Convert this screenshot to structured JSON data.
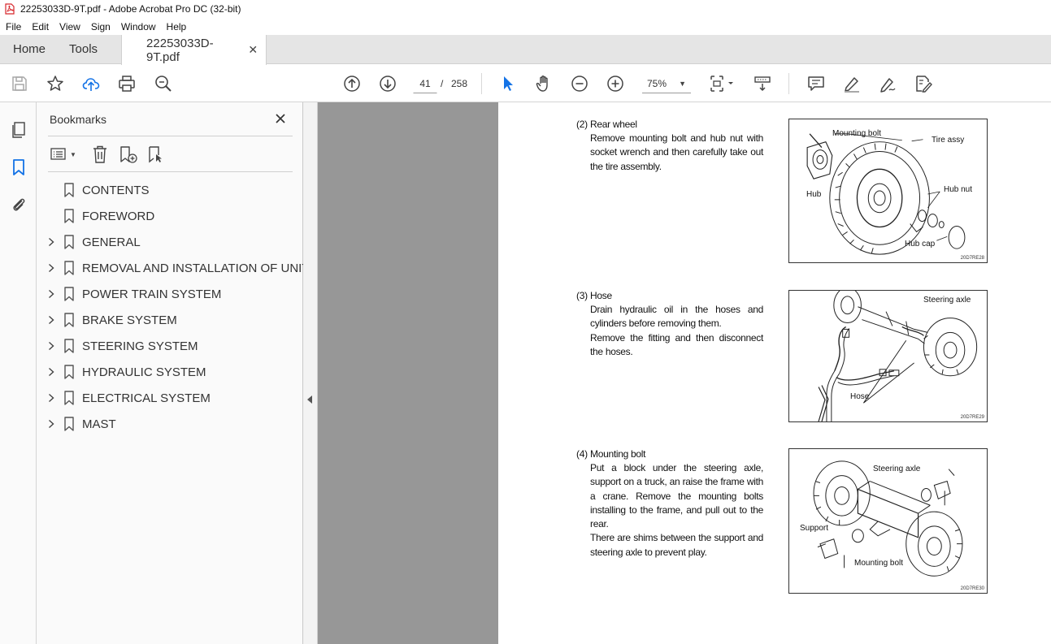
{
  "window": {
    "title": "22253033D-9T.pdf - Adobe Acrobat Pro DC (32-bit)"
  },
  "menu": [
    "File",
    "Edit",
    "View",
    "Sign",
    "Window",
    "Help"
  ],
  "tabs": {
    "home": "Home",
    "tools": "Tools",
    "document": "22253033D-9T.pdf"
  },
  "toolbar": {
    "current_page": "41",
    "page_separator": "/",
    "total_pages": "258",
    "zoom": "75%"
  },
  "bookmarks": {
    "title": "Bookmarks",
    "items": [
      {
        "label": "CONTENTS",
        "expandable": false
      },
      {
        "label": "FOREWORD",
        "expandable": false
      },
      {
        "label": "GENERAL",
        "expandable": true
      },
      {
        "label": "REMOVAL AND INSTALLATION OF UNIT",
        "expandable": true
      },
      {
        "label": "POWER TRAIN SYSTEM",
        "expandable": true
      },
      {
        "label": "BRAKE SYSTEM",
        "expandable": true
      },
      {
        "label": "STEERING SYSTEM",
        "expandable": true
      },
      {
        "label": "HYDRAULIC SYSTEM",
        "expandable": true
      },
      {
        "label": "ELECTRICAL SYSTEM",
        "expandable": true
      },
      {
        "label": "MAST",
        "expandable": true
      }
    ]
  },
  "document": {
    "sections": [
      {
        "number": "(2)",
        "heading": "Rear wheel",
        "paragraphs": [
          "Remove mounting bolt and hub nut with socket wrench and then carefully take out the tire assembly."
        ]
      },
      {
        "number": "(3)",
        "heading": "Hose",
        "paragraphs": [
          "Drain hydraulic oil in the hoses and cylinders before removing them.",
          "Remove the fitting and then disconnect the hoses."
        ]
      },
      {
        "number": "(4)",
        "heading": "Mounting bolt",
        "paragraphs": [
          "Put a block under the steering axle, support on a truck, an raise the frame with a crane.  Remove the mounting bolts installing to the frame, and pull out to the rear.",
          "There are shims between the support and steering axle to prevent play."
        ]
      }
    ],
    "figures": [
      {
        "labels": {
          "mounting_bolt": "Mounting bolt",
          "tire_assy": "Tire assy",
          "hub": "Hub",
          "hub_nut": "Hub nut",
          "hub_cap": "Hub cap"
        },
        "code": "20D7RE28"
      },
      {
        "labels": {
          "steering_axle": "Steering axle",
          "hose": "Hose"
        },
        "code": "20D7RE29"
      },
      {
        "labels": {
          "steering_axle": "Steering axle",
          "support": "Support",
          "mounting_bolt": "Mounting bolt"
        },
        "code": "20D7RE30"
      }
    ]
  },
  "colors": {
    "acrobat_red": "#d7262b",
    "accent_blue": "#1473e6",
    "gutter_gray": "#979797"
  }
}
